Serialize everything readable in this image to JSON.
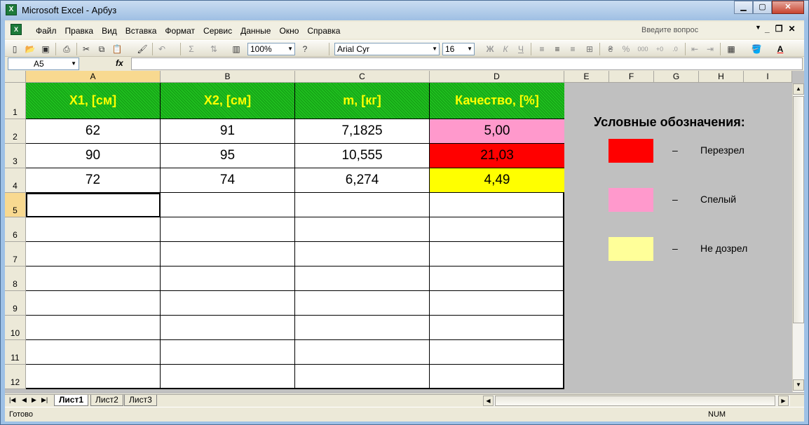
{
  "window": {
    "title": "Microsoft Excel - Арбуз",
    "app_icon": "excel-icon",
    "controls": [
      "minimize",
      "maximize",
      "close"
    ]
  },
  "menu": {
    "items": [
      "Файл",
      "Правка",
      "Вид",
      "Вставка",
      "Формат",
      "Сервис",
      "Данные",
      "Окно",
      "Справка"
    ],
    "help_placeholder": "Введите вопрос"
  },
  "toolbar": {
    "zoom": "100%",
    "font_name": "Arial Cyr",
    "font_size": "16",
    "bold": "Ж",
    "italic": "К",
    "underline": "Ч",
    "percent": "%",
    "thousands": "000",
    "sigma": "Σ",
    "fill_color": "#ffff00",
    "font_color": "#ff0000"
  },
  "formula_bar": {
    "name_box": "A5",
    "fx_label": "fx",
    "content": ""
  },
  "grid": {
    "columns": [
      "A",
      "B",
      "C",
      "D",
      "E",
      "F",
      "G",
      "H",
      "I"
    ],
    "rows": [
      "1",
      "2",
      "3",
      "4",
      "5",
      "6",
      "7",
      "8",
      "9",
      "10",
      "11",
      "12"
    ],
    "active_column": "A",
    "active_row": "5",
    "header": [
      "X1, [см]",
      "X2, [см]",
      "m, [кг]",
      "Качество, [%]"
    ],
    "data": [
      [
        "62",
        "91",
        "7,1825",
        "5,00"
      ],
      [
        "90",
        "95",
        "10,555",
        "21,03"
      ],
      [
        "72",
        "74",
        "6,274",
        "4,49"
      ]
    ],
    "quality_colors": [
      "#ff99cc",
      "#ff0000",
      "#ffff00"
    ],
    "header_color": "#1fbf1f",
    "header_text_color": "#ffff00"
  },
  "legend": {
    "title": "Условные обозначения:",
    "items": [
      {
        "color": "#ff0000",
        "dash": "–",
        "label": "Перезрел"
      },
      {
        "color": "#ff99cc",
        "dash": "–",
        "label": "Спелый"
      },
      {
        "color": "#ffff99",
        "dash": "–",
        "label": "Не дозрел"
      }
    ]
  },
  "sheet_tabs": [
    "Лист1",
    "Лист2",
    "Лист3"
  ],
  "active_tab": "Лист1",
  "status": {
    "text": "Готово",
    "num": "NUM"
  }
}
